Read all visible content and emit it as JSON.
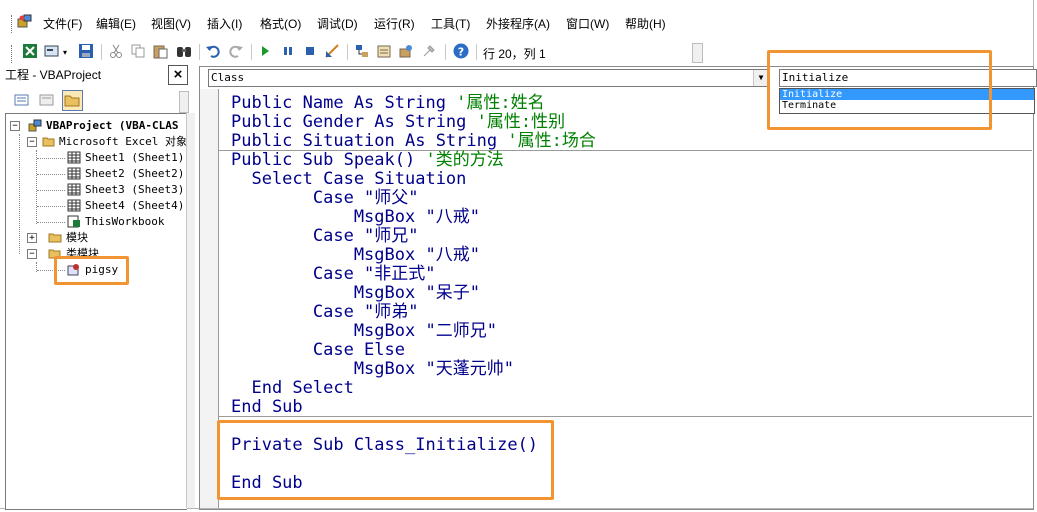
{
  "menu": {
    "items": [
      "文件(F)",
      "编辑(E)",
      "视图(V)",
      "插入(I)",
      "格式(O)",
      "调试(D)",
      "运行(R)",
      "工具(T)",
      "外接程序(A)",
      "窗口(W)",
      "帮助(H)"
    ]
  },
  "toolbar": {
    "position_text": "行 20，列 1"
  },
  "project": {
    "title": "工程 - VBAProject",
    "close_label": "×",
    "root": "VBAProject (VBA-CLAS",
    "excel_objects": "Microsoft Excel 对象",
    "sheets": [
      "Sheet1 (Sheet1)",
      "Sheet2 (Sheet2)",
      "Sheet3 (Sheet3)",
      "Sheet4 (Sheet4)",
      "ThisWorkbook"
    ],
    "modules_folder": "模块",
    "class_modules_folder": "类模块",
    "class_module": "pigsy"
  },
  "code": {
    "object_combo": "Class",
    "proc_combo": "Initialize",
    "proc_options": [
      "Initialize",
      "Terminate"
    ],
    "lines": [
      {
        "code": "Public Name As String ",
        "comment": "'属性:姓名"
      },
      {
        "code": "Public Gender As String ",
        "comment": "'属性:性别"
      },
      {
        "code": "Public Situation As String ",
        "comment": "'属性:场合"
      },
      {
        "code": "Public Sub Speak() ",
        "comment": "'类的方法"
      },
      {
        "code": "  Select Case Situation",
        "comment": ""
      },
      {
        "code": "        Case \"师父\"",
        "comment": ""
      },
      {
        "code": "            MsgBox \"八戒\"",
        "comment": ""
      },
      {
        "code": "        Case \"师兄\"",
        "comment": ""
      },
      {
        "code": "            MsgBox \"八戒\"",
        "comment": ""
      },
      {
        "code": "        Case \"非正式\"",
        "comment": ""
      },
      {
        "code": "            MsgBox \"呆子\"",
        "comment": ""
      },
      {
        "code": "        Case \"师弟\"",
        "comment": ""
      },
      {
        "code": "            MsgBox \"二师兄\"",
        "comment": ""
      },
      {
        "code": "        Case Else",
        "comment": ""
      },
      {
        "code": "            MsgBox \"天蓬元帅\"",
        "comment": ""
      },
      {
        "code": "  End Select",
        "comment": ""
      },
      {
        "code": "End Sub",
        "comment": ""
      },
      {
        "code": "Private Sub Class_Initialize()",
        "comment": ""
      },
      {
        "code": "",
        "comment": ""
      },
      {
        "code": "End Sub",
        "comment": ""
      }
    ]
  },
  "colors": {
    "keyword": "#00008b",
    "comment": "#008000",
    "highlight": "#f39433",
    "selection": "#3399ff"
  }
}
